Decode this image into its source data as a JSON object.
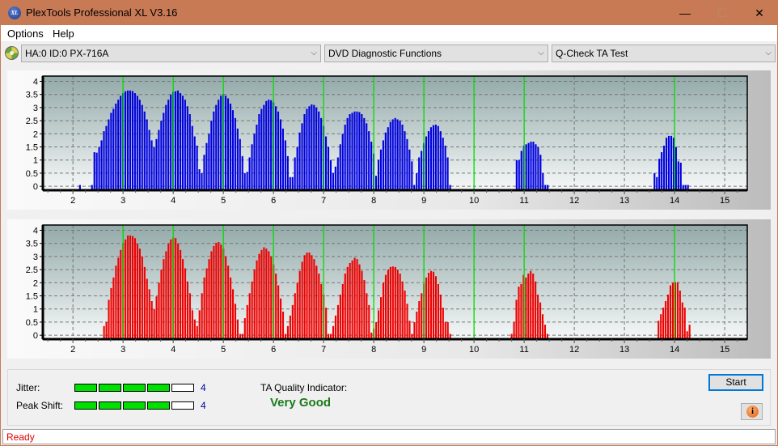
{
  "window": {
    "title": "PlexTools Professional XL V3.16",
    "app_icon": "XL",
    "controls": {
      "minimize": "—",
      "maximize": "☐",
      "close": "✕"
    }
  },
  "menu": [
    {
      "label": "Options"
    },
    {
      "label": "Help"
    }
  ],
  "toolbar": {
    "drive_icon": "disc-icon",
    "drive": "HA:0 ID:0  PX-716A",
    "function": "DVD Diagnostic Functions",
    "test": "Q-Check TA Test",
    "arrow": "⌵"
  },
  "chart_data": [
    {
      "type": "bar",
      "name": "ta-land-top",
      "color": "#0000e0",
      "xlim": [
        1.4,
        15.45
      ],
      "ylim": [
        -0.15,
        4.2
      ],
      "xticks": [
        "2",
        "3",
        "4",
        "5",
        "6",
        "7",
        "8",
        "9",
        "10",
        "11",
        "12",
        "13",
        "14",
        "15"
      ],
      "yticks": [
        "0",
        "0.5",
        "1",
        "1.5",
        "2",
        "2.5",
        "3",
        "3.5",
        "4"
      ],
      "marker_lines": [
        3,
        4,
        5,
        6,
        7,
        8,
        9,
        10,
        11,
        14
      ],
      "grid": true,
      "clusters": [
        {
          "start": 2.14,
          "values": [
            0.05
          ]
        },
        {
          "start": 2.38,
          "values": [
            0.05,
            1.3,
            1.28,
            1.5,
            1.75,
            2.1,
            2.3,
            2.55,
            2.8,
            2.95,
            3.15,
            3.3,
            3.45,
            3.55,
            3.62,
            3.65,
            3.65,
            3.63,
            3.55,
            3.45,
            3.3,
            3.1,
            2.85,
            2.55,
            2.15,
            1.75,
            1.5,
            1.8,
            2.15,
            2.5,
            2.8,
            3.1,
            3.3,
            3.5,
            3.6,
            3.62,
            3.65,
            3.55,
            3.45,
            3.3,
            3.05,
            2.75,
            2.3,
            1.9,
            1.55,
            0.65,
            0.5,
            1.2,
            1.65,
            2.0,
            2.5,
            2.85,
            3.1,
            3.3,
            3.45,
            3.52,
            3.45,
            3.35,
            3.15,
            2.9,
            2.6,
            2.2,
            1.8,
            1.15,
            0.5,
            0.55,
            1.1,
            1.6,
            2.0,
            2.35,
            2.75,
            2.95,
            3.1,
            3.25,
            3.3,
            3.28,
            3.2,
            3.05,
            2.85,
            2.55,
            2.2,
            1.75,
            1.15,
            0.35,
            0.35,
            1.1,
            1.5,
            2.05,
            2.4,
            2.75,
            2.95,
            3.05,
            3.12,
            3.1,
            3.0,
            2.85,
            2.6,
            2.3,
            1.9,
            1.5,
            1.0,
            0.5,
            0.75,
            1.1,
            1.6,
            2.0,
            2.35,
            2.6,
            2.75,
            2.8,
            2.85,
            2.85,
            2.83,
            2.75,
            2.6,
            2.4,
            2.1,
            1.7,
            1.25,
            0.4,
            1.0,
            1.4,
            1.75,
            2.05,
            2.25,
            2.45,
            2.55,
            2.6,
            2.55,
            2.5,
            2.35,
            2.1,
            1.8,
            1.4,
            0.95,
            0.05,
            0.5,
            1.1,
            1.35,
            1.65,
            1.9,
            2.1,
            2.25,
            2.33,
            2.35,
            2.3,
            2.1,
            1.85,
            1.55,
            1.1,
            0.05
          ]
        },
        {
          "start": 10.85,
          "values": [
            1.0,
            1.0,
            1.35,
            1.55,
            1.6,
            1.65,
            1.7,
            1.7,
            1.6,
            1.5,
            1.2,
            0.5,
            0.05,
            0.05
          ]
        },
        {
          "start": 13.6,
          "values": [
            0.5,
            0.35,
            1.05,
            1.3,
            1.55,
            1.85,
            1.92,
            1.92,
            1.85,
            1.5,
            0.95,
            0.9,
            0.05,
            0.05,
            0.05
          ]
        }
      ]
    },
    {
      "type": "bar",
      "name": "ta-pit-bottom",
      "color": "#f00000",
      "xlim": [
        1.4,
        15.45
      ],
      "ylim": [
        -0.15,
        4.2
      ],
      "xticks": [
        "2",
        "3",
        "4",
        "5",
        "6",
        "7",
        "8",
        "9",
        "10",
        "11",
        "12",
        "13",
        "14",
        "15"
      ],
      "yticks": [
        "0",
        "0.5",
        "1",
        "1.5",
        "2",
        "2.5",
        "3",
        "3.5",
        "4"
      ],
      "marker_lines": [
        3,
        4,
        5,
        6,
        7,
        8,
        9,
        10,
        11,
        14
      ],
      "grid": true,
      "clusters": [
        {
          "start": 2.62,
          "values": [
            0.35,
            0.5,
            1.35,
            1.8,
            2.2,
            2.65,
            2.95,
            3.25,
            3.5,
            3.65,
            3.8,
            3.8,
            3.78,
            3.7,
            3.5,
            3.3,
            3.0,
            2.6,
            2.15,
            1.75,
            1.3,
            1.0,
            1.48,
            2.0,
            2.5,
            2.9,
            3.2,
            3.5,
            3.65,
            3.72,
            3.7,
            3.5,
            3.25,
            2.9,
            2.55,
            2.05,
            1.6,
            0.95,
            0.6,
            0.35,
            0.95,
            1.6,
            2.2,
            2.55,
            2.9,
            3.2,
            3.4,
            3.52,
            3.55,
            3.45,
            3.3,
            3.0,
            2.65,
            2.2,
            1.75,
            1.2,
            0.6,
            0.05,
            0.05,
            0.65,
            1.15,
            1.6,
            2.05,
            2.5,
            2.85,
            3.1,
            3.25,
            3.35,
            3.3,
            3.2,
            3.0,
            2.7,
            2.35,
            1.9,
            1.4,
            0.9,
            0.05,
            0.35,
            0.75,
            1.15,
            1.6,
            2.0,
            2.45,
            2.8,
            3.05,
            3.15,
            3.15,
            3.05,
            2.9,
            2.65,
            2.35,
            1.95,
            1.55,
            1.05,
            0.05,
            0.05,
            0.35,
            0.75,
            1.15,
            1.55,
            1.95,
            2.35,
            2.6,
            2.75,
            2.85,
            2.95,
            2.9,
            2.7,
            2.45,
            2.1,
            1.6,
            1.15,
            0.1,
            0.25,
            0.5,
            0.95,
            1.45,
            2.0,
            2.3,
            2.5,
            2.6,
            2.62,
            2.6,
            2.5,
            2.35,
            2.05,
            1.7,
            1.2,
            0.55,
            0.05,
            0.5,
            0.9,
            1.3,
            1.6,
            1.95,
            2.2,
            2.38,
            2.45,
            2.42,
            2.25,
            1.95,
            1.55,
            1.05,
            0.5,
            0.5,
            0.05
          ]
        },
        {
          "start": 10.75,
          "values": [
            0.05,
            0.5,
            1.35,
            1.85,
            1.95,
            2.3,
            2.2,
            2.35,
            2.45,
            2.35,
            2.05,
            1.55,
            1.25,
            0.8,
            0.4,
            0.05
          ]
        },
        {
          "start": 13.68,
          "values": [
            0.55,
            0.8,
            1.05,
            1.3,
            1.55,
            1.9,
            2.0,
            2.02,
            2.02,
            1.7,
            1.25,
            1.05,
            0.15,
            0.4
          ]
        }
      ]
    }
  ],
  "metrics": {
    "jitter": {
      "label": "Jitter:",
      "value": "4",
      "level": 4,
      "max": 5
    },
    "peak_shift": {
      "label": "Peak Shift:",
      "value": "4",
      "level": 4,
      "max": 5
    },
    "ta_quality_label": "TA Quality Indicator:",
    "ta_quality_value": "Very Good"
  },
  "buttons": {
    "start": "Start",
    "info_icon": "i"
  },
  "status": "Ready"
}
